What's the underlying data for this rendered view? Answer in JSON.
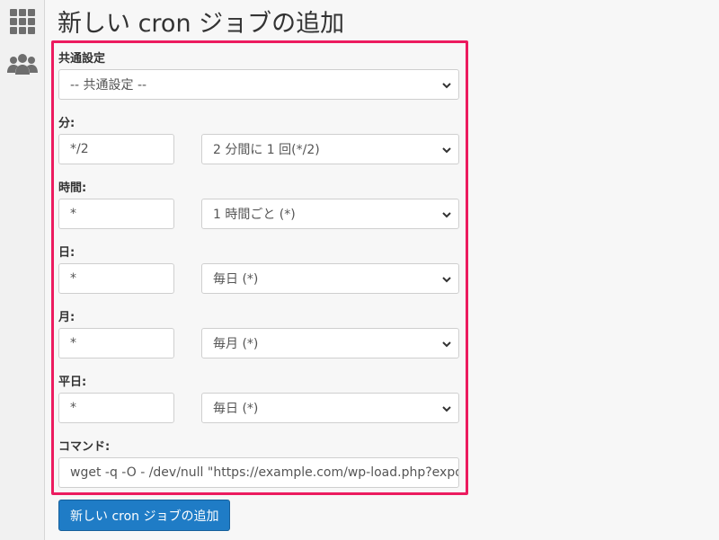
{
  "sidebar": {
    "icons": [
      {
        "name": "apps-grid-icon"
      },
      {
        "name": "users-icon"
      }
    ]
  },
  "page": {
    "title": "新しい cron ジョブの追加"
  },
  "form": {
    "common": {
      "label": "共通設定",
      "selected": "-- 共通設定 --"
    },
    "minute": {
      "label": "分:",
      "value": "*/2",
      "selected": "2 分間に 1 回(*/2)"
    },
    "hour": {
      "label": "時間:",
      "value": "*",
      "selected": "1 時間ごと (*)"
    },
    "day": {
      "label": "日:",
      "value": "*",
      "selected": "毎日 (*)"
    },
    "month": {
      "label": "月:",
      "value": "*",
      "selected": "毎月 (*)"
    },
    "weekday": {
      "label": "平日:",
      "value": "*",
      "selected": "毎日 (*)"
    },
    "command": {
      "label": "コマンド:",
      "value": "wget -q -O - /dev/null \"https://example.com/wp-load.php?export_"
    },
    "submit_label": "新しい cron ジョブの追加"
  },
  "colors": {
    "highlight": "#ec1b5f",
    "primary": "#1f7cc6"
  }
}
